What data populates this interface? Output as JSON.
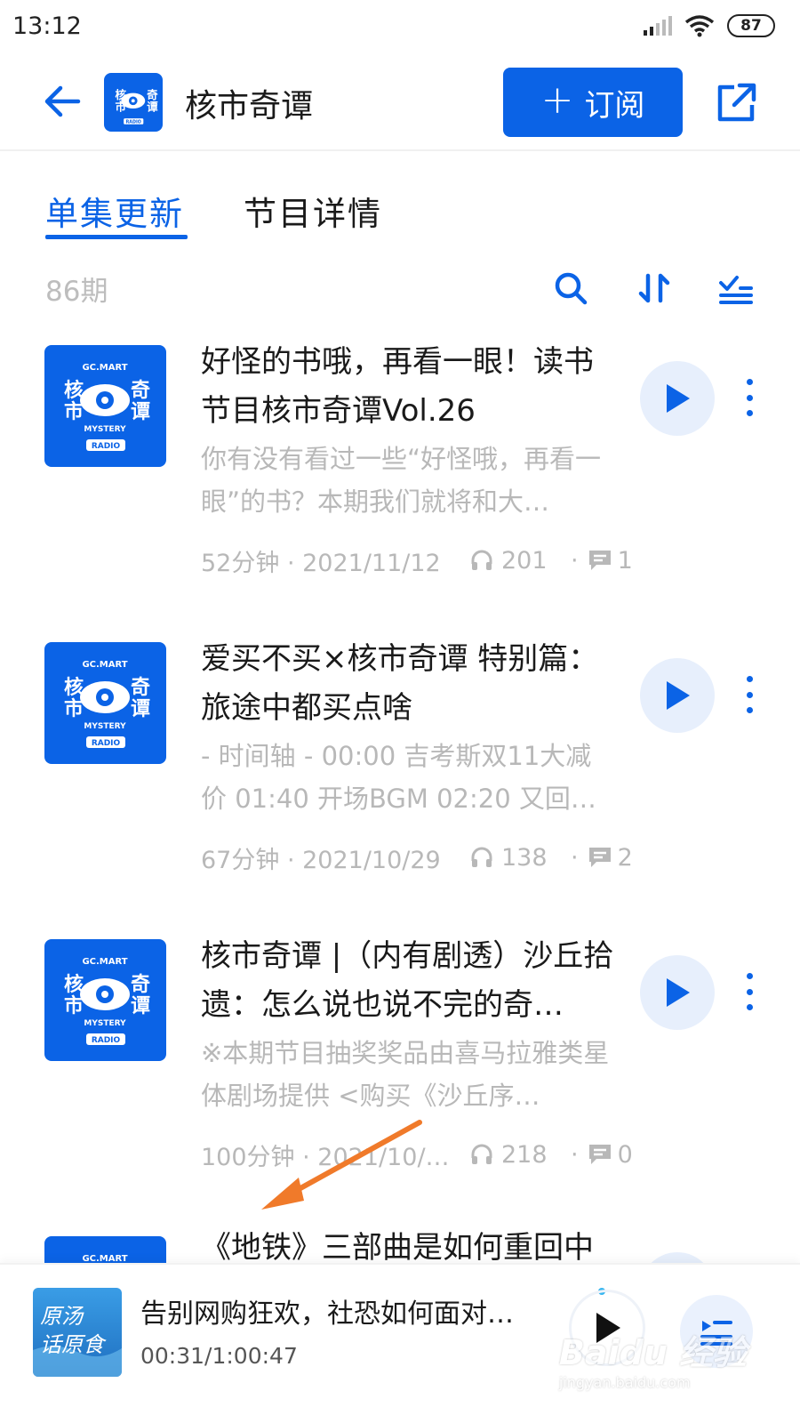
{
  "status_bar": {
    "time": "13:12",
    "battery": "87"
  },
  "header": {
    "title": "核市奇谭",
    "subscribe_label": "订阅",
    "subscribe_plus": "+"
  },
  "tabs": [
    {
      "label": "单集更新",
      "active": true
    },
    {
      "label": "节目详情",
      "active": false
    }
  ],
  "toolbar": {
    "episode_count": "86期"
  },
  "logo": {
    "top_text": "GC.MART",
    "left": "核市",
    "right": "奇谭",
    "bottom": "MYSTERY",
    "radio": "RADIO"
  },
  "episodes": [
    {
      "title": "好怪的书哦，再看一眼！读书节目核市奇谭Vol.26",
      "desc": "你有没有看过一些“好怪哦，再看一眼”的书？本期我们就将和大…",
      "duration_date": "52分钟 · 2021/11/12",
      "listens": "201",
      "comments": "1"
    },
    {
      "title": "爱买不买×核市奇谭 特别篇：旅途中都买点啥",
      "desc": "- 时间轴 - 00:00 吉考斯双11大减价 01:40 开场BGM 02:20 又回…",
      "duration_date": "67分钟 · 2021/10/29",
      "listens": "138",
      "comments": "2"
    },
    {
      "title": "核市奇谭 |（内有剧透）沙丘拾遗：怎么说也说不完的奇…",
      "desc": "※本期节目抽奖奖品由喜马拉雅类星体剧场提供 <购买《沙丘序…",
      "duration_date": "100分钟 · 2021/10/…",
      "listens": "218",
      "comments": "0"
    },
    {
      "title": "《地铁》三部曲是如何重回中",
      "desc": "",
      "duration_date": "",
      "listens": "",
      "comments": ""
    }
  ],
  "mini_player": {
    "title": "告别网购狂欢，社恐如何面对…",
    "time": "00:31/1:00:47",
    "cover_text": "原汤话原食"
  },
  "colors": {
    "accent": "#0b63e6",
    "arrow": "#f07a2a"
  },
  "watermark": {
    "brand": "Baidu 经验",
    "url": "jingyan.baidu.com"
  }
}
